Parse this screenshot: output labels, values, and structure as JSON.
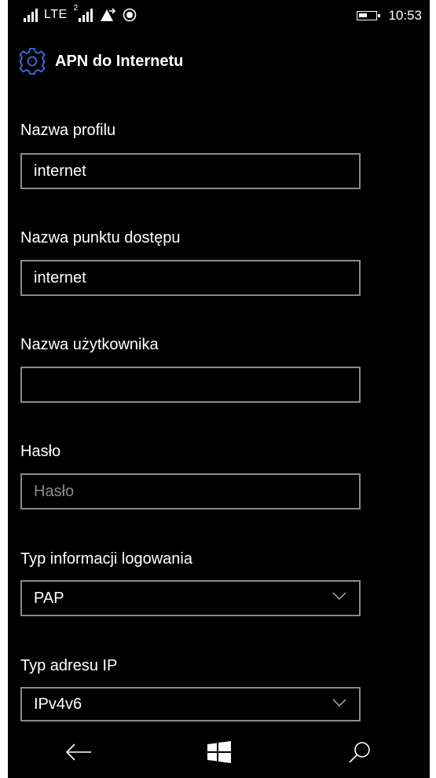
{
  "status_bar": {
    "network_type": "LTE",
    "sim2_tag": "2",
    "time": "10:53"
  },
  "header": {
    "title": "APN do Internetu",
    "icon": "gear-icon",
    "accent_color": "#3b6ee8"
  },
  "form": {
    "profile_name": {
      "label": "Nazwa profilu",
      "value": "internet"
    },
    "access_point": {
      "label": "Nazwa punktu dostępu",
      "value": "internet"
    },
    "username": {
      "label": "Nazwa użytkownika",
      "value": ""
    },
    "password": {
      "label": "Hasło",
      "placeholder": "Hasło"
    },
    "login_type": {
      "label": "Typ informacji logowania",
      "value": "PAP"
    },
    "ip_type": {
      "label": "Typ adresu IP",
      "value": "IPv4v6"
    }
  },
  "nav_bar": {
    "back_icon": "back-arrow-icon",
    "home_icon": "windows-logo-icon",
    "search_icon": "search-icon"
  }
}
